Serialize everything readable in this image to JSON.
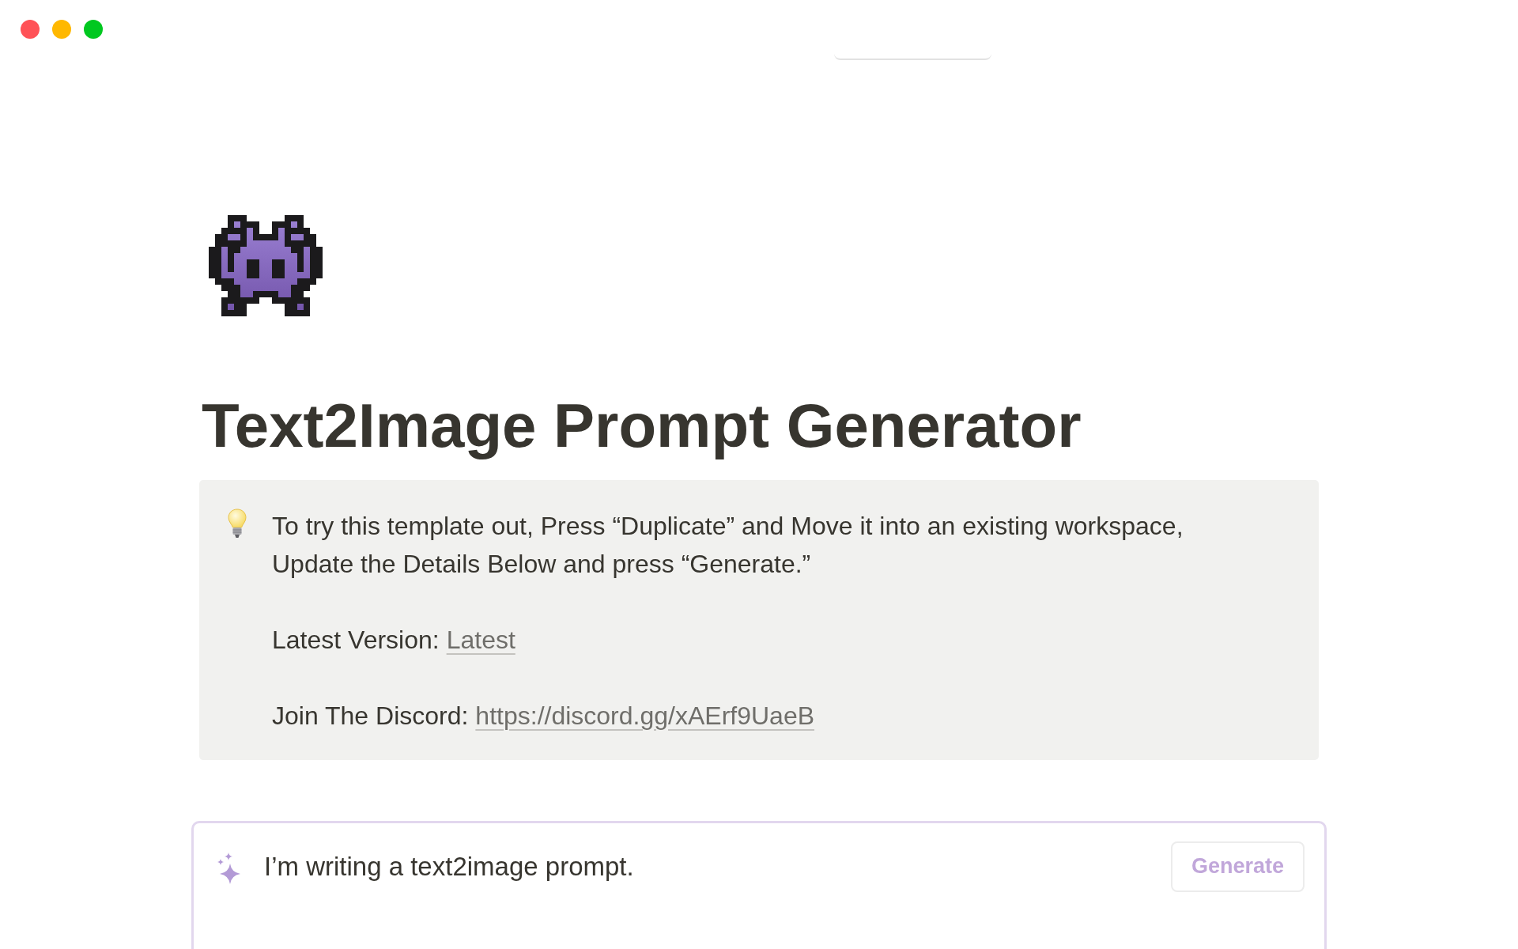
{
  "window_controls": [
    {
      "color": "#ff5257"
    },
    {
      "color": "#ffb800"
    },
    {
      "color": "#00c820"
    }
  ],
  "page": {
    "title": "Text2Image Prompt Generator"
  },
  "callout": {
    "paragraphs": [
      {
        "kind": "text",
        "text": "To try this template out, Press “Duplicate” and Move it into an existing workspace, Update the Details Below and press “Generate.”"
      },
      {
        "kind": "link",
        "label": "Latest Version:",
        "link": "Latest"
      },
      {
        "kind": "link",
        "label": "Join The Discord:",
        "link": "https://discord.gg/xAErf9UaeB"
      }
    ]
  },
  "ai_block": {
    "prompt": "I’m writing a text2image prompt.",
    "button": "Generate"
  }
}
